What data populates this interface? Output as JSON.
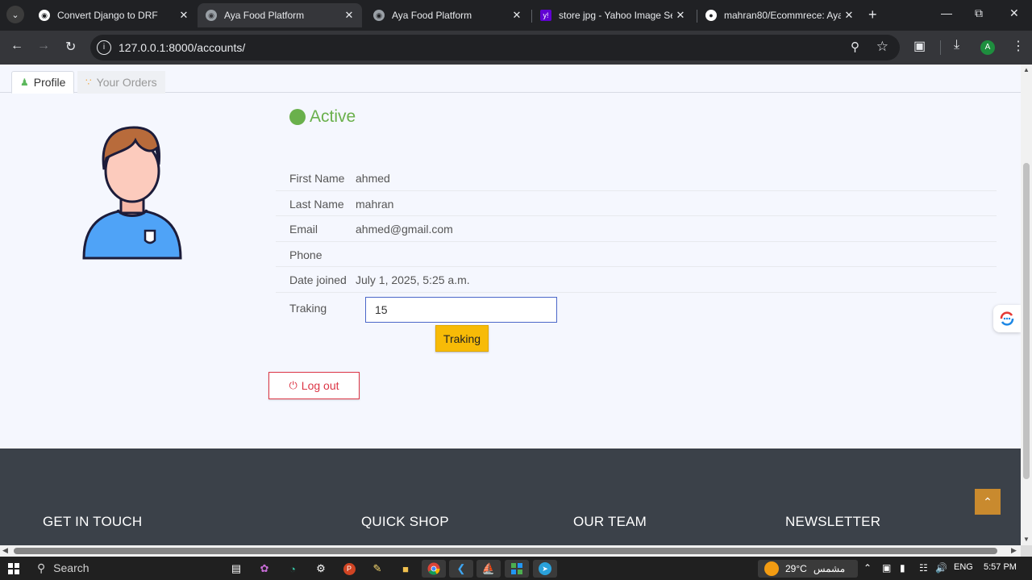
{
  "browser": {
    "tabs": [
      {
        "title": "Convert Django to DRF",
        "active": false
      },
      {
        "title": "Aya Food Platform",
        "active": true
      },
      {
        "title": "Aya Food Platform",
        "active": false
      },
      {
        "title": "store jpg - Yahoo Image Sea",
        "active": false
      },
      {
        "title": "mahran80/Ecommrece: Aya",
        "active": false
      }
    ],
    "url": "127.0.0.1:8000/accounts/",
    "profile_initial": "A"
  },
  "page": {
    "tabs": [
      {
        "label": "Profile",
        "icon": "user-icon",
        "active": true
      },
      {
        "label": "Your Orders",
        "icon": "rss-icon",
        "active": false
      }
    ],
    "status": {
      "label": "Active",
      "color": "#6ab04c"
    },
    "info": [
      {
        "label": "First Name",
        "value": "ahmed"
      },
      {
        "label": "Last Name",
        "value": "mahran"
      },
      {
        "label": "Email",
        "value": "ahmed@gmail.com"
      },
      {
        "label": "Phone",
        "value": ""
      },
      {
        "label": "Date joined",
        "value": "July 1, 2025, 5:25 a.m."
      }
    ],
    "tracking": {
      "label": "Traking",
      "value": "15",
      "button": "Traking"
    },
    "logout_label": "Log out",
    "footer": {
      "headings": [
        "GET IN TOUCH",
        "QUICK SHOP",
        "OUR TEAM",
        "NEWSLETTER"
      ]
    }
  },
  "taskbar": {
    "search_label": "Search",
    "weather": {
      "temp": "29°C",
      "condition": "مشمس"
    },
    "language": "ENG",
    "time": "5:57 PM"
  }
}
